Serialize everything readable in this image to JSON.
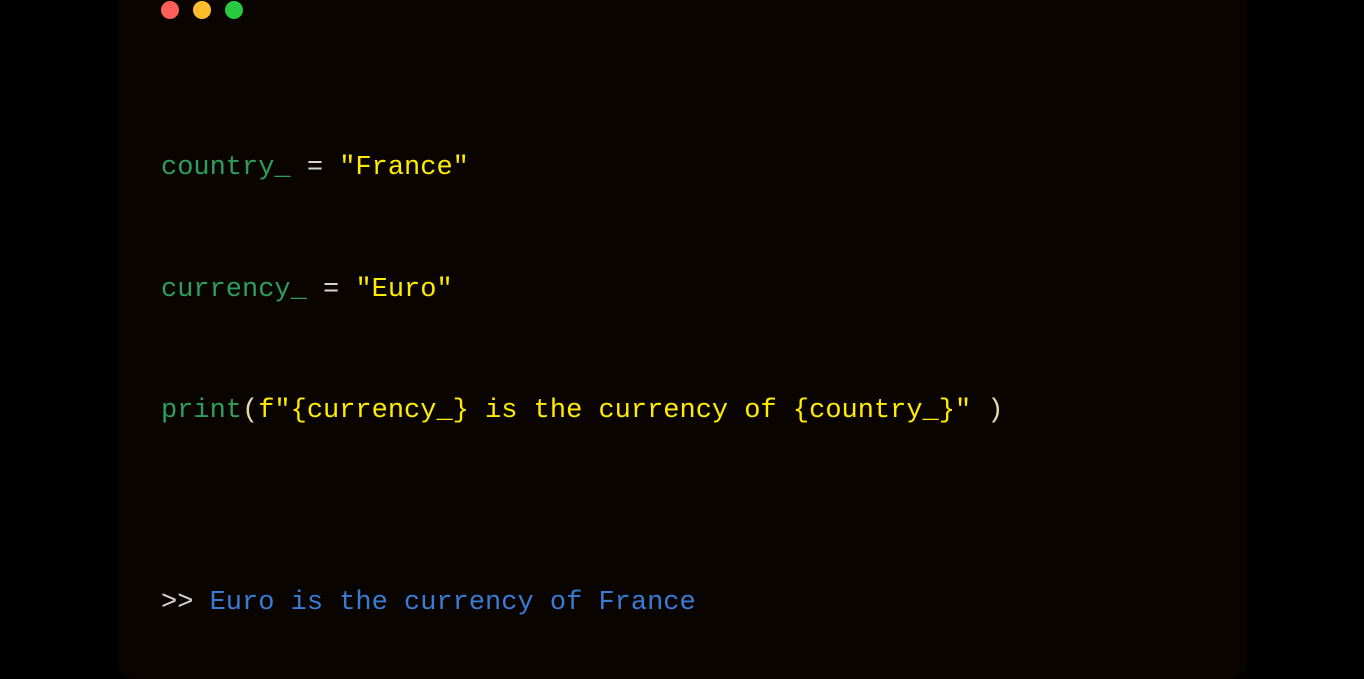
{
  "window": {
    "traffic_lights": {
      "red": "close",
      "yellow": "minimize",
      "green": "maximize"
    }
  },
  "code": {
    "line1": {
      "var": "country_",
      "eq": " = ",
      "str": "\"France\""
    },
    "line2": {
      "var": "currency_",
      "eq": " = ",
      "str": "\"Euro\""
    },
    "line3": {
      "fn": "print",
      "open": "(",
      "fprefix": "f",
      "str_open": "\"",
      "interp1_open": "{",
      "interp1_var": "currency_",
      "interp1_close": "}",
      "mid": " is the currency of ",
      "interp2_open": "{",
      "interp2_var": "country_",
      "interp2_close": "}",
      "str_close": "\"",
      "space": " ",
      "close": ")"
    }
  },
  "output": {
    "prompt": ">> ",
    "text": "Euro is the currency of France"
  }
}
